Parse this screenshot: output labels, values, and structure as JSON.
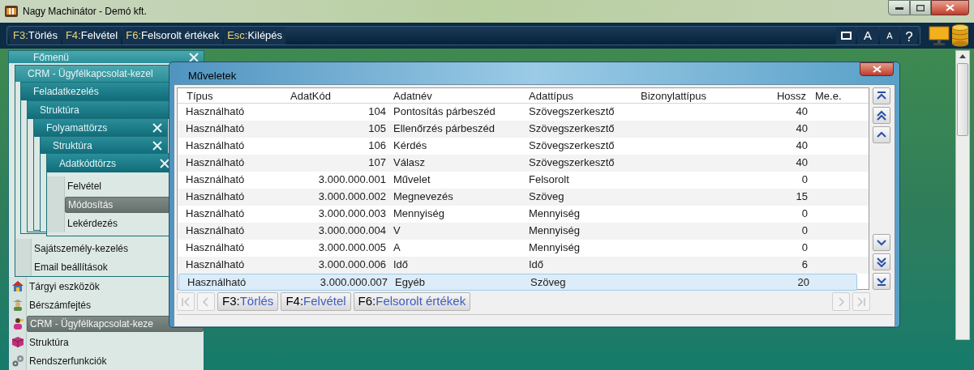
{
  "window": {
    "title": "Nagy Machinátor - Demó kft."
  },
  "toolbar": {
    "shortcuts": [
      {
        "key": "F3:",
        "label": "Törlés"
      },
      {
        "key": "F4:",
        "label": "Felvétel"
      },
      {
        "key": "F6:",
        "label": "Felsorolt értékek"
      },
      {
        "key": "Esc:",
        "label": "Kilépés"
      }
    ],
    "font_buttons": [
      "A",
      "A"
    ],
    "help": "?"
  },
  "menu_panels": [
    {
      "title": "Főmenü",
      "closable": true,
      "items": [
        {
          "label": "Tárgyi eszközök",
          "selected": false
        },
        {
          "label": "Bérszámfejtés",
          "selected": false
        },
        {
          "label": "CRM - Ügyfélkapcsolat-keze",
          "selected": true
        },
        {
          "label": "Struktúra",
          "selected": false
        },
        {
          "label": "Rendszerfunkciók",
          "selected": false
        }
      ]
    },
    {
      "title": "CRM - Ügyfélkapcsolat-kezel",
      "closable": false,
      "items": [
        {
          "label": "Sajátszemély-kezelés",
          "selected": false
        },
        {
          "label": "Email beállítások",
          "selected": false
        }
      ]
    },
    {
      "title": "Feladatkezelés",
      "closable": false
    },
    {
      "title": "Struktúra",
      "closable": false
    },
    {
      "title": "Folyamattörzs",
      "closable": true
    },
    {
      "title": "Struktúra",
      "closable": true
    },
    {
      "title": "Adatkódtörzs",
      "closable": true,
      "items": [
        {
          "label": "Felvétel",
          "selected": false
        },
        {
          "label": "Módosítás",
          "selected": true
        },
        {
          "label": "Lekérdezés",
          "selected": false
        }
      ]
    }
  ],
  "dialog": {
    "title": "Műveletek",
    "columns": [
      "Típus",
      "AdatKód",
      "Adatnév",
      "Adattípus",
      "Bizonylattípus",
      "Hossz",
      "Me.e."
    ],
    "rows": [
      {
        "cells": [
          "Használható",
          "104",
          "Pontosítás párbeszéd",
          "Szövegszerkesztő",
          "",
          "40",
          ""
        ],
        "selected": false
      },
      {
        "cells": [
          "Használható",
          "105",
          "Ellenőrzés párbeszéd",
          "Szövegszerkesztő",
          "",
          "40",
          ""
        ],
        "selected": false
      },
      {
        "cells": [
          "Használható",
          "106",
          "Kérdés",
          "Szövegszerkesztő",
          "",
          "40",
          ""
        ],
        "selected": false
      },
      {
        "cells": [
          "Használható",
          "107",
          "Válasz",
          "Szövegszerkesztő",
          "",
          "40",
          ""
        ],
        "selected": false
      },
      {
        "cells": [
          "Használható",
          "3.000.000.001",
          "Művelet",
          "Felsorolt",
          "",
          "0",
          ""
        ],
        "selected": false
      },
      {
        "cells": [
          "Használható",
          "3.000.000.002",
          "Megnevezés",
          "Szöveg",
          "",
          "15",
          ""
        ],
        "selected": false
      },
      {
        "cells": [
          "Használható",
          "3.000.000.003",
          "Mennyiség",
          "Mennyiség",
          "",
          "0",
          ""
        ],
        "selected": false
      },
      {
        "cells": [
          "Használható",
          "3.000.000.004",
          "V",
          "Mennyiség",
          "",
          "0",
          ""
        ],
        "selected": false
      },
      {
        "cells": [
          "Használható",
          "3.000.000.005",
          "A",
          "Mennyiség",
          "",
          "0",
          ""
        ],
        "selected": false
      },
      {
        "cells": [
          "Használható",
          "3.000.000.006",
          "Idő",
          "Idő",
          "",
          "6",
          ""
        ],
        "selected": false
      },
      {
        "cells": [
          "Használható",
          "3.000.000.007",
          "Egyéb",
          "Szöveg",
          "",
          "20",
          ""
        ],
        "selected": true
      }
    ],
    "buttons": [
      {
        "key": "F3:",
        "label": "Törlés"
      },
      {
        "key": "F4:",
        "label": "Felvétel"
      },
      {
        "key": "F6:",
        "label": "Felsorolt értékek"
      }
    ]
  }
}
